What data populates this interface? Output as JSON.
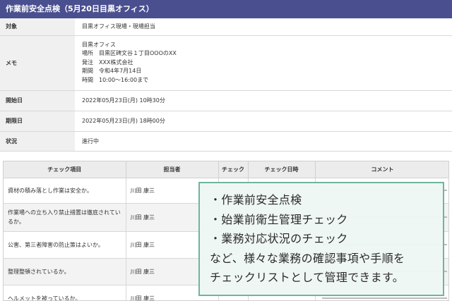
{
  "title": "作業前安全点検（5月20日目黒オフィス）",
  "info": {
    "target": {
      "label": "対象",
      "value": "目黒オフィス現場・現場担当"
    },
    "memo": {
      "label": "メモ",
      "lines": [
        "目黒オフィス",
        "場所　目黒区碑文谷１丁目OOOのXX",
        "発注　XXX株式会社",
        "期間　令和4年7月14日",
        "時間　10:00～16:00まで"
      ]
    },
    "start": {
      "label": "開始日",
      "value": "2022年05月23日(月) 10時30分"
    },
    "deadline": {
      "label": "期限日",
      "value": "2022年05月23日(月) 18時00分"
    },
    "status": {
      "label": "状況",
      "value": "進行中"
    }
  },
  "checklist": {
    "headers": {
      "item": "チェック項目",
      "owner": "担当者",
      "check": "チェック",
      "date": "チェック日時",
      "comment": "コメント"
    },
    "rows": [
      {
        "item": "資材の積み落とし作業は安全か。",
        "owner": "川田 康三"
      },
      {
        "item": "作業場への立ち入り禁止措置は徹底されているか。",
        "owner": "川田 康三"
      },
      {
        "item": "公害、第三者障害の防止策はよいか。",
        "owner": "川田 康三"
      },
      {
        "item": "整理整頓されているか。",
        "owner": "川田 康三"
      },
      {
        "item": "ヘルメットを被っているか。",
        "owner": "川田 康三"
      }
    ]
  },
  "callout": {
    "lines": [
      "・作業前安全点検",
      "・始業前衛生管理チェック",
      "・業務対応状況のチェック",
      "など、様々な業務の確認事項や手順を",
      "チェックリストとして管理できます。"
    ]
  }
}
